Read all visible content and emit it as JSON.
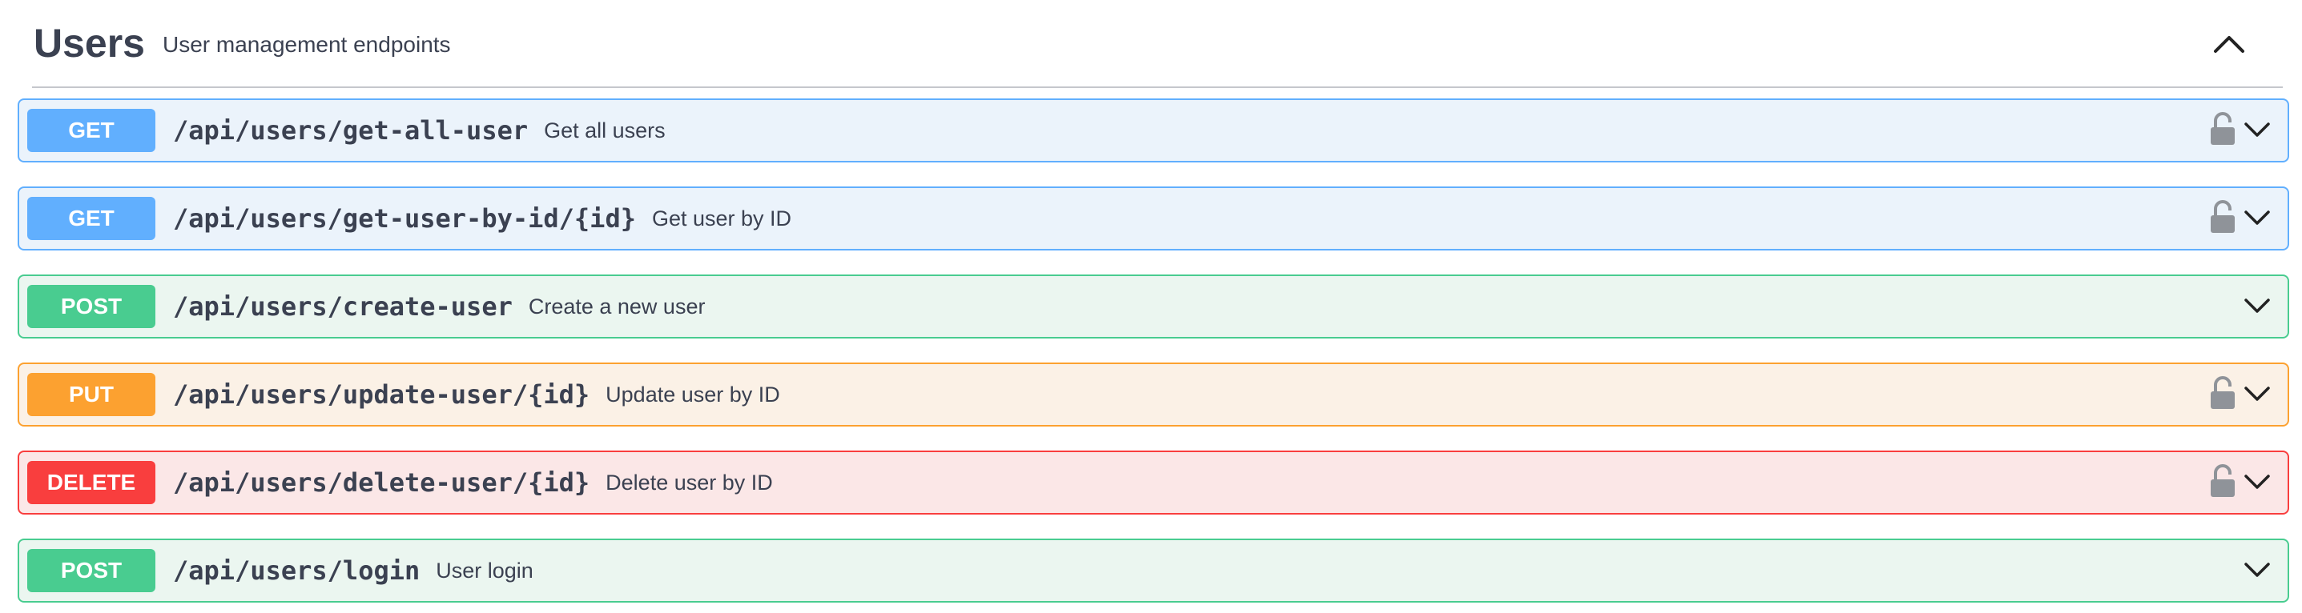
{
  "tag": {
    "title": "Users",
    "description": "User management endpoints",
    "toggle_icon": "chevron-up-icon"
  },
  "operations": [
    {
      "method": "GET",
      "path": "/api/users/get-all-user",
      "summary": "Get all users",
      "locked": true,
      "color": "#61affe"
    },
    {
      "method": "GET",
      "path": "/api/users/get-user-by-id/{id}",
      "summary": "Get user by ID",
      "locked": true,
      "color": "#61affe"
    },
    {
      "method": "POST",
      "path": "/api/users/create-user",
      "summary": "Create a new user",
      "locked": false,
      "color": "#49cc90"
    },
    {
      "method": "PUT",
      "path": "/api/users/update-user/{id}",
      "summary": "Update user by ID",
      "locked": true,
      "color": "#fca130"
    },
    {
      "method": "DELETE",
      "path": "/api/users/delete-user/{id}",
      "summary": "Delete user by ID",
      "locked": true,
      "color": "#f93e3e"
    },
    {
      "method": "POST",
      "path": "/api/users/login",
      "summary": "User login",
      "locked": false,
      "color": "#49cc90"
    }
  ]
}
